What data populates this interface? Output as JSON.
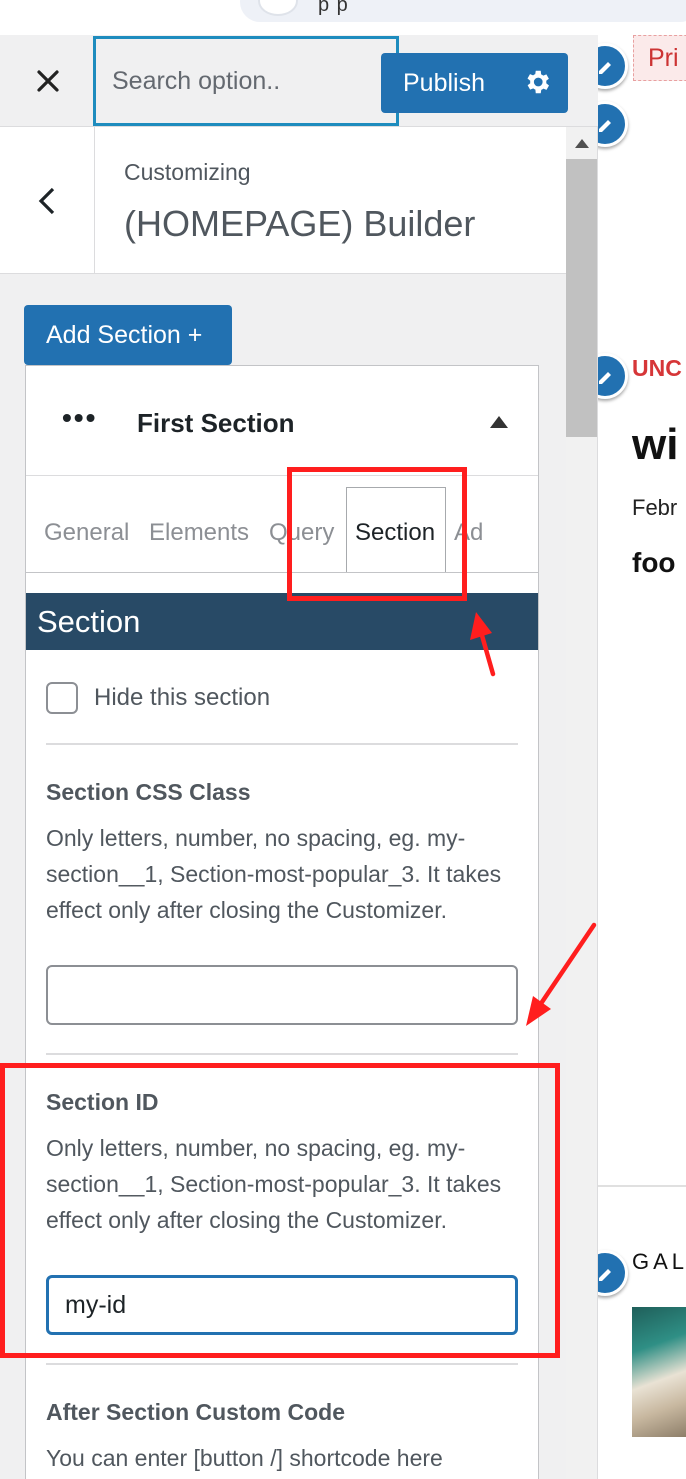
{
  "browser": {
    "address_text": "p                    p"
  },
  "header": {
    "close_icon": "close-icon",
    "search_placeholder": "Search option..",
    "publish_label": "Publish",
    "publish_icon": "gear-icon"
  },
  "title_bar": {
    "small": "Customizing",
    "big": "(HOMEPAGE) Builder"
  },
  "add_section_label": "Add Section +",
  "card": {
    "dots": "•••",
    "title": "First Section",
    "tabs": [
      "General",
      "Elements",
      "Query",
      "Section",
      "Ad"
    ],
    "active_tab": "Section",
    "banner": "Section",
    "hide_label": "Hide this section",
    "css_class": {
      "title": "Section CSS Class",
      "desc": "Only letters, number, no spacing, eg. my-section__1, Section-most-popular_3. It takes effect only after closing the Customizer.",
      "value": ""
    },
    "section_id": {
      "title": "Section ID",
      "desc": "Only letters, number, no spacing, eg. my-section__1, Section-most-popular_3. It takes effect only after closing the Customizer.",
      "value": "my-id"
    },
    "after_code": {
      "title": "After Section Custom Code",
      "desc": "You can enter [button /] shortcode here"
    }
  },
  "preview": {
    "pri": "Pri",
    "category": "UNC",
    "post_title": "wi",
    "date": "Febr",
    "foo": "foo",
    "gallery": "GAL"
  },
  "colors": {
    "accent": "#2271b1",
    "banner": "#284a66",
    "annotation_red": "#ff1e1e",
    "category_red": "#d63638"
  }
}
